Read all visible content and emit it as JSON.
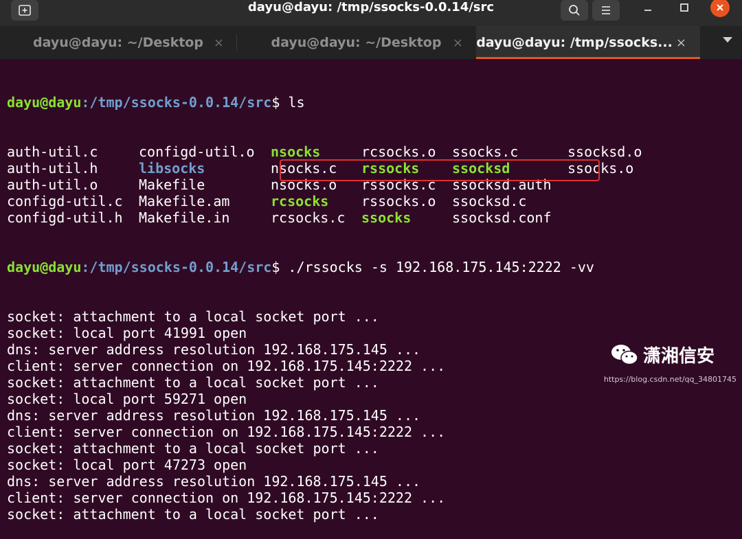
{
  "window": {
    "title": "dayu@dayu: /tmp/ssocks-0.0.14/src",
    "new_tab_icon": "new-tab-icon",
    "search_icon": "search-icon",
    "menu_icon": "hamburger-menu-icon"
  },
  "tabs": [
    {
      "label": "dayu@dayu: ~/Desktop",
      "active": false
    },
    {
      "label": "dayu@dayu: ~/Desktop",
      "active": false
    },
    {
      "label": "dayu@dayu: /tmp/ssocks...",
      "active": true
    }
  ],
  "prompt": {
    "userhost": "dayu@dayu",
    "path": ":/tmp/ssocks-0.0.14/src",
    "symbol": "$ "
  },
  "ls_command": "ls",
  "ls_output": [
    [
      "auth-util.c",
      "configd-util.o",
      "nsocks",
      "rcsocks.o",
      "ssocks.c",
      "ssocksd.o"
    ],
    [
      "auth-util.h",
      "libsocks",
      "nsocks.c",
      "rssocks",
      "ssocksd",
      "ssocks.o"
    ],
    [
      "auth-util.o",
      "Makefile",
      "nsocks.o",
      "rssocks.c",
      "ssocksd.auth",
      ""
    ],
    [
      "configd-util.c",
      "Makefile.am",
      "rcsocks",
      "rssocks.o",
      "ssocksd.c",
      ""
    ],
    [
      "configd-util.h",
      "Makefile.in",
      "rcsocks.c",
      "ssocks",
      "ssocksd.conf",
      ""
    ]
  ],
  "ls_kinds": [
    [
      "f",
      "f",
      "e",
      "f",
      "f",
      "f"
    ],
    [
      "f",
      "d",
      "f",
      "e",
      "e",
      "f"
    ],
    [
      "f",
      "f",
      "f",
      "f",
      "f",
      "f"
    ],
    [
      "f",
      "f",
      "e",
      "f",
      "f",
      "f"
    ],
    [
      "f",
      "f",
      "f",
      "e",
      "f",
      "f"
    ]
  ],
  "run_command": "./rssocks -s 192.168.175.145:2222 -vv",
  "output_lines": [
    "socket: attachment to a local socket port ...",
    "socket: local port 41991 open",
    "dns: server address resolution 192.168.175.145 ...",
    "client: server connection on 192.168.175.145:2222 ...",
    "socket: attachment to a local socket port ...",
    "socket: local port 59271 open",
    "dns: server address resolution 192.168.175.145 ...",
    "client: server connection on 192.168.175.145:2222 ...",
    "socket: attachment to a local socket port ...",
    "socket: local port 47273 open",
    "dns: server address resolution 192.168.175.145 ...",
    "client: server connection on 192.168.175.145:2222 ...",
    "socket: attachment to a local socket port ..."
  ],
  "watermark": {
    "text": "潇湘信安",
    "icon": "wechat-icon",
    "url": "https://blog.csdn.net/qq_34801745"
  },
  "colors": {
    "background": "#300a24",
    "prompt_user": "#8ae234",
    "prompt_path": "#729fcf",
    "executable": "#8ae234",
    "directory": "#729fcf",
    "highlight_box": "#e03030",
    "active_tab_underline": "#e95420"
  }
}
